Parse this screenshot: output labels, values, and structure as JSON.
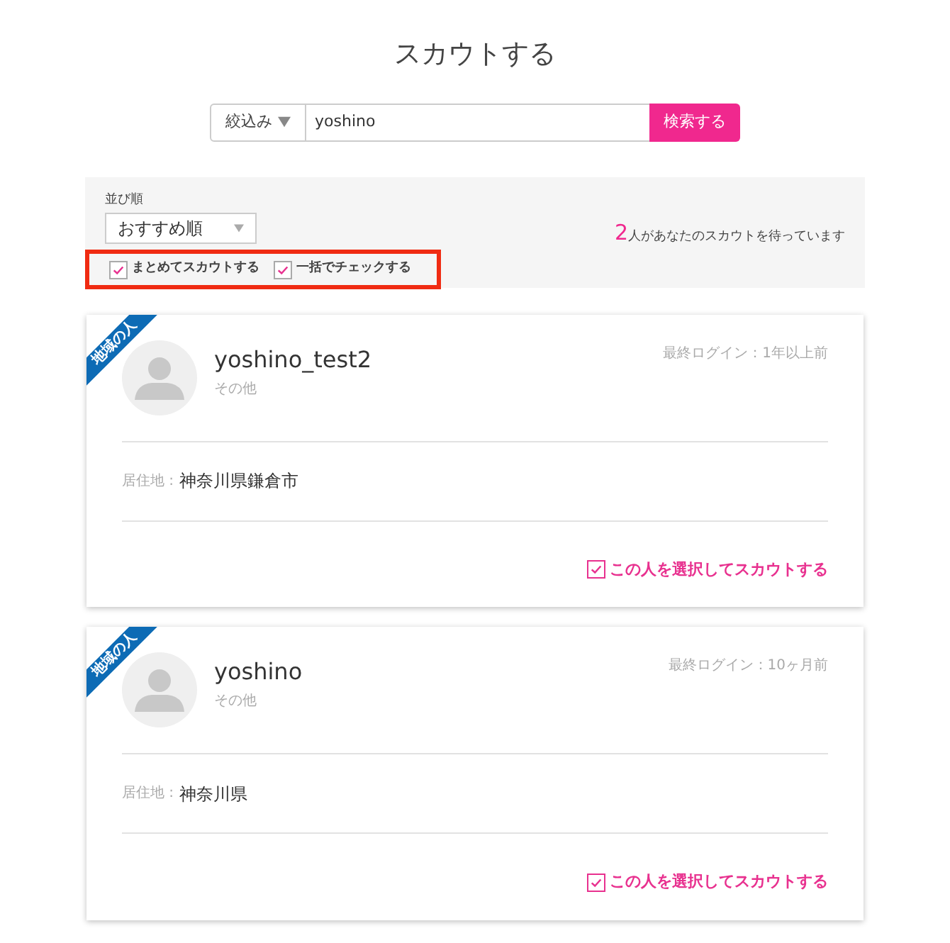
{
  "page_title": "スカウトする",
  "search": {
    "filter_label": "絞込み",
    "value": "yoshino",
    "button": "検索する"
  },
  "sort": {
    "label": "並び順",
    "value": "おすすめ順"
  },
  "bulk_options": {
    "highlighted": true,
    "items": [
      {
        "label": "まとめてスカウトする",
        "checked": true
      },
      {
        "label": "一括でチェックする",
        "checked": true
      }
    ]
  },
  "waiting": {
    "count": "2",
    "text": "人があなたのスカウトを待っています"
  },
  "candidates": [
    {
      "ribbon": "地域の人",
      "name": "yoshino_test2",
      "category": "その他",
      "last_login": "最終ログイン：1年以上前",
      "residence_label": "居住地 :",
      "residence": "神奈川県鎌倉市",
      "select_label": "この人を選択してスカウトする",
      "checked": true
    },
    {
      "ribbon": "地域の人",
      "name": "yoshino",
      "category": "その他",
      "last_login": "最終ログイン：10ヶ月前",
      "residence_label": "居住地 :",
      "residence": "神奈川県",
      "select_label": "この人を選択してスカウトする",
      "checked": true
    }
  ]
}
